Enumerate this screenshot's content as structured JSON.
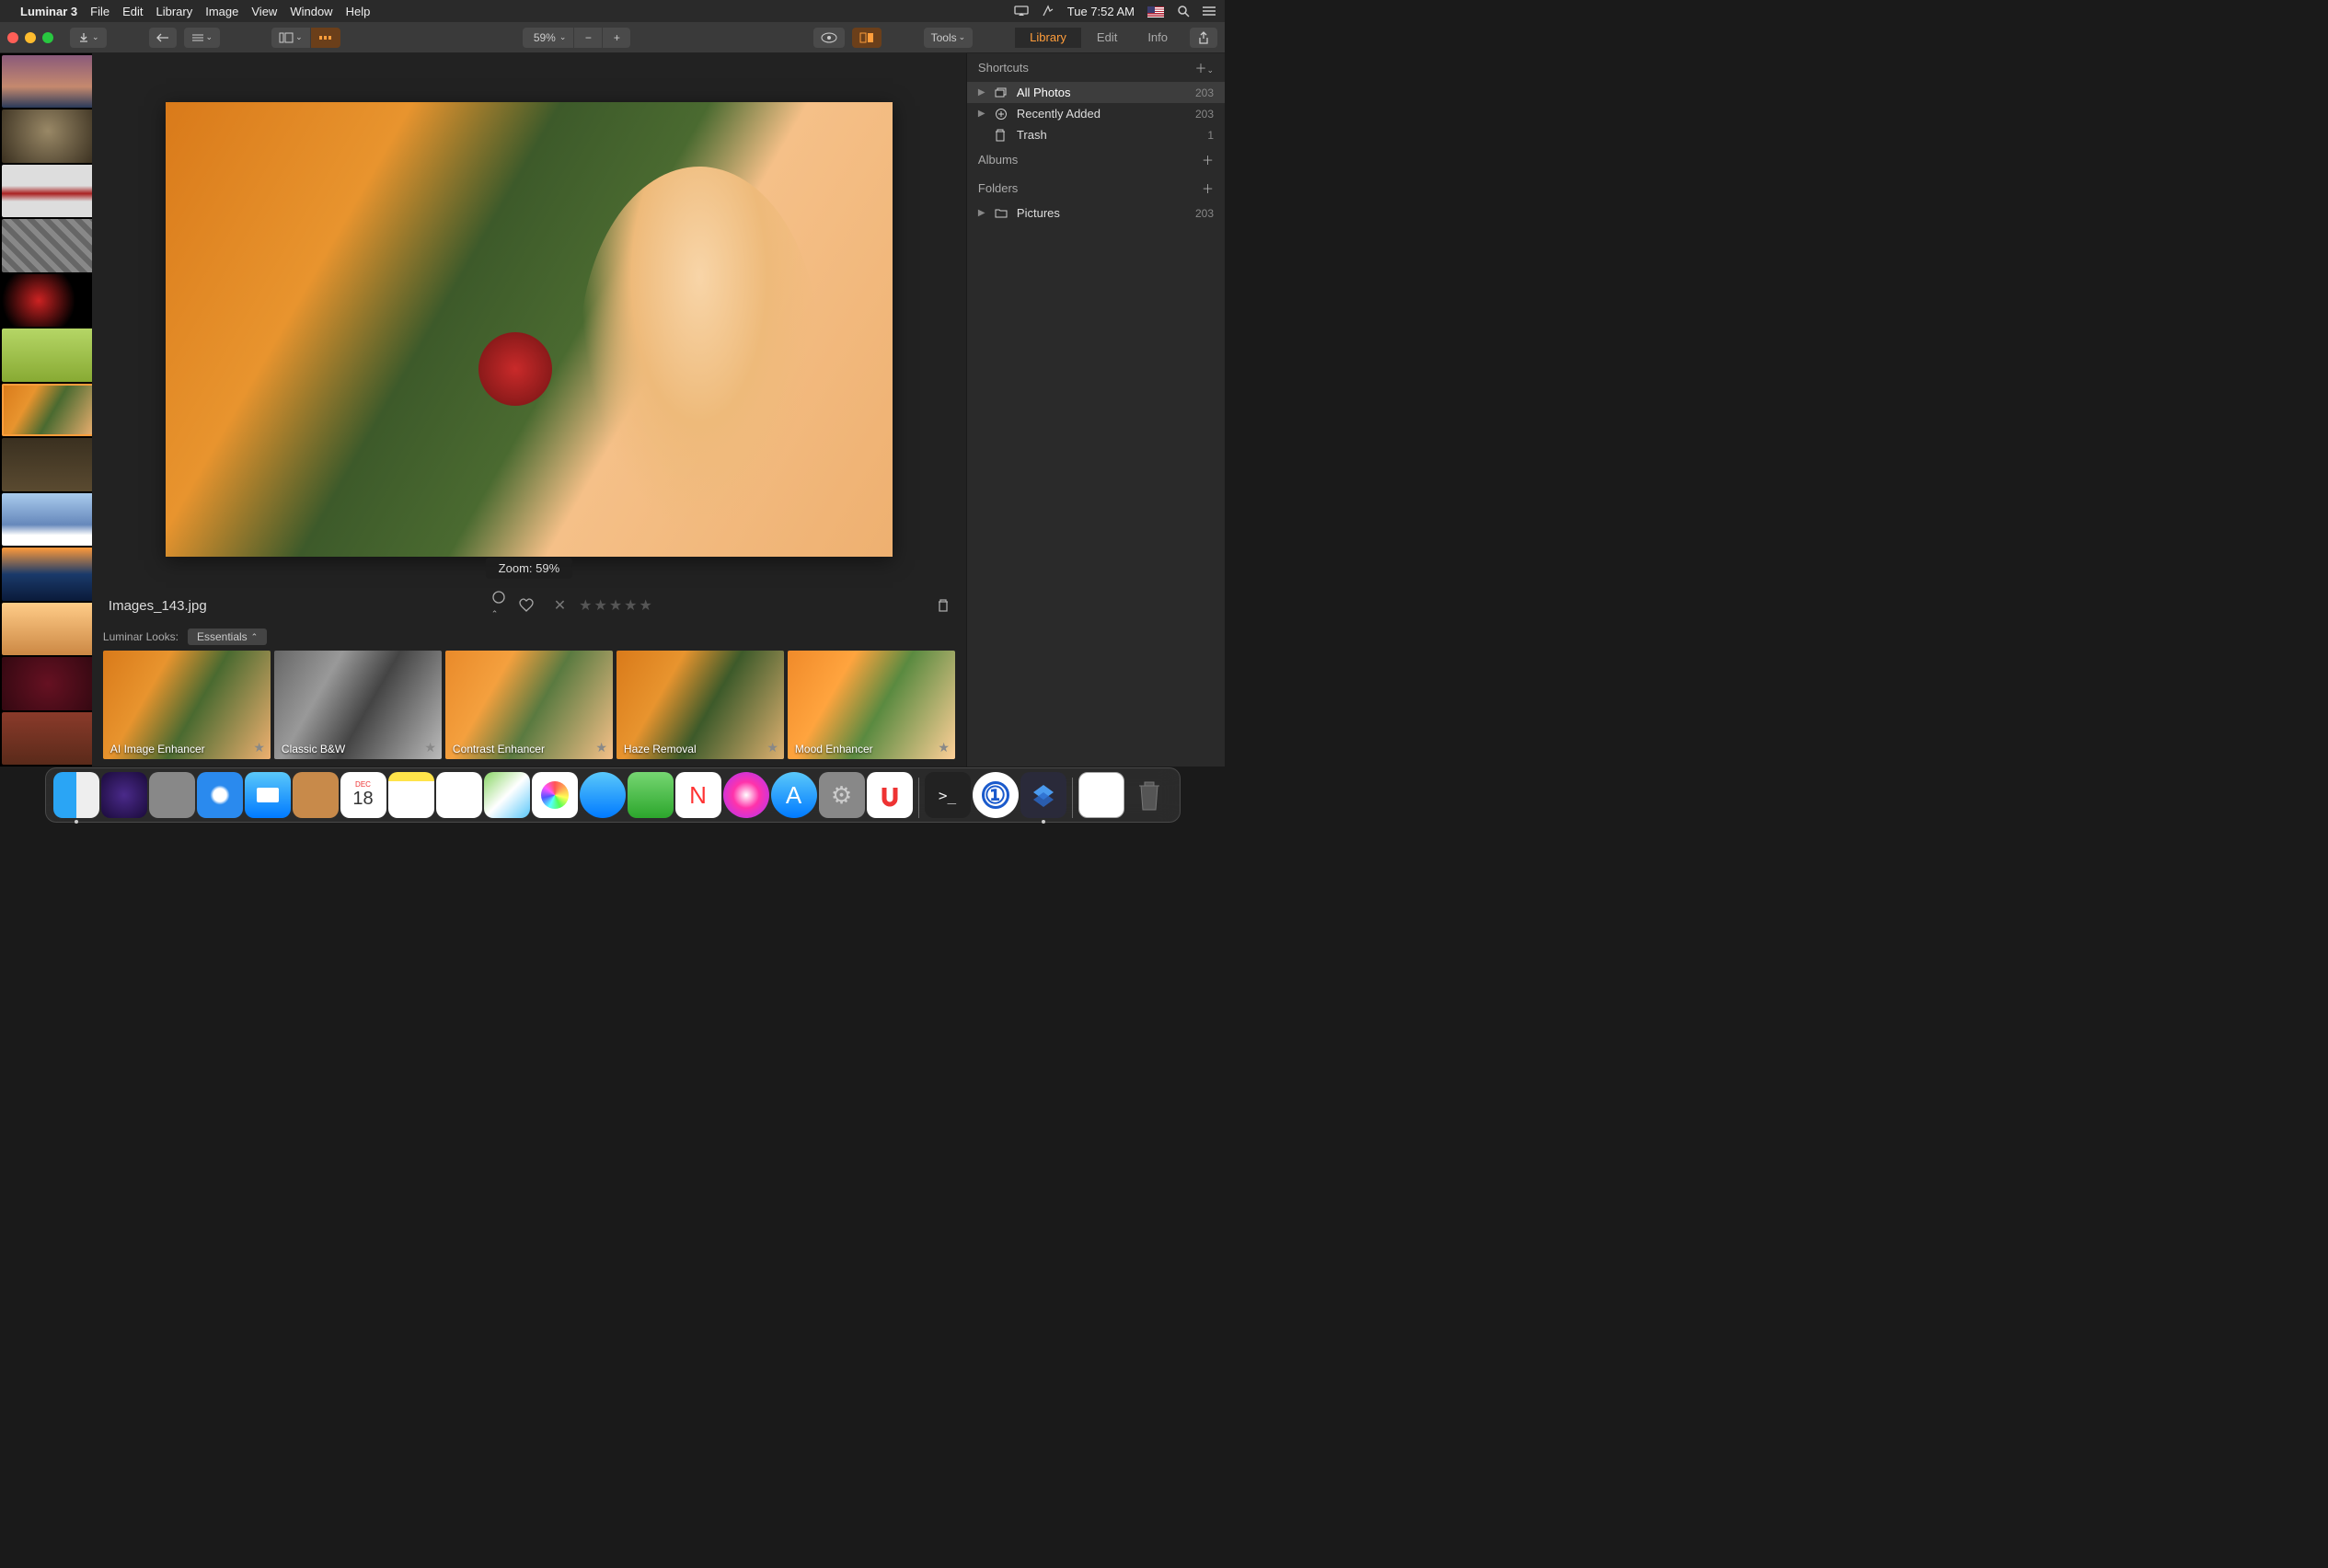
{
  "menubar": {
    "app_name": "Luminar 3",
    "items": [
      "File",
      "Edit",
      "Library",
      "Image",
      "View",
      "Window",
      "Help"
    ],
    "clock": "Tue 7:52 AM"
  },
  "toolbar": {
    "zoom_value": "59%",
    "tools_label": "Tools",
    "tabs": {
      "library": "Library",
      "edit": "Edit",
      "info": "Info"
    }
  },
  "viewer": {
    "zoom_tooltip": "Zoom: 59%",
    "filename": "Images_143.jpg"
  },
  "looks": {
    "header_label": "Luminar Looks:",
    "category": "Essentials",
    "items": [
      {
        "name": "AI Image Enhancer"
      },
      {
        "name": "Classic B&W"
      },
      {
        "name": "Contrast Enhancer"
      },
      {
        "name": "Haze Removal"
      },
      {
        "name": "Mood Enhancer"
      }
    ]
  },
  "sidebar": {
    "shortcuts_label": "Shortcuts",
    "albums_label": "Albums",
    "folders_label": "Folders",
    "rows": {
      "all_photos": {
        "label": "All Photos",
        "count": "203"
      },
      "recently_added": {
        "label": "Recently Added",
        "count": "203"
      },
      "trash": {
        "label": "Trash",
        "count": "1"
      },
      "pictures": {
        "label": "Pictures",
        "count": "203"
      }
    }
  },
  "dock": {
    "items": [
      "finder",
      "siri",
      "launchpad",
      "safari",
      "mail",
      "contacts",
      "calendar",
      "notes",
      "reminders",
      "maps",
      "photos",
      "messages",
      "facetime",
      "news",
      "itunes",
      "appstore",
      "preferences",
      "magnet",
      "sep",
      "terminal",
      "1password",
      "luminar",
      "sep",
      "textedit",
      "trash"
    ],
    "calendar_day": "18",
    "calendar_month": "DEC"
  }
}
